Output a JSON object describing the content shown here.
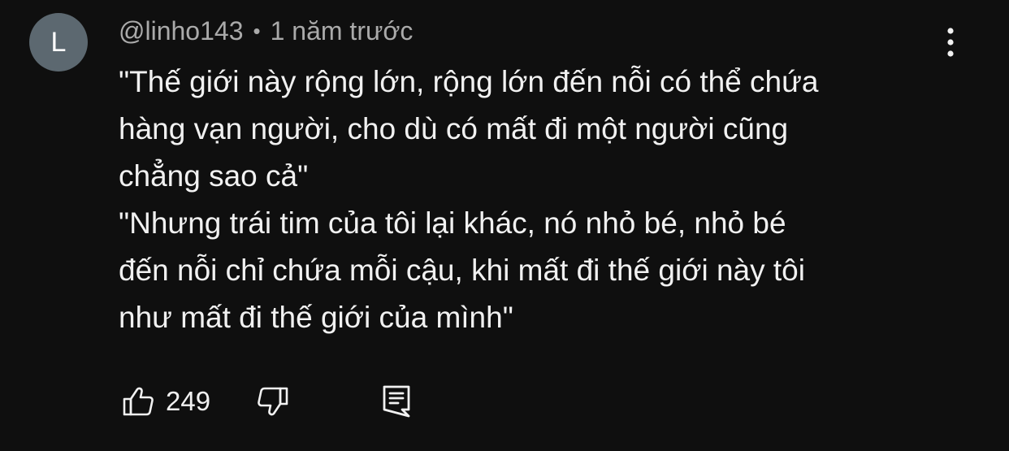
{
  "comment": {
    "avatar_letter": "L",
    "author": "@linho143",
    "separator": "•",
    "time": "1 năm trước",
    "text_lines": [
      "\"Thế giới này rộng lớn, rộng lớn đến nỗi có thể chứa",
      "hàng vạn người, cho dù có mất đi một người cũng",
      "chẳng sao cả\"",
      "\"Nhưng trái tim của tôi lại khác, nó nhỏ bé, nhỏ bé",
      "đến nỗi chỉ chứa mỗi cậu, khi mất đi thế giới này tôi",
      "như mất đi thế giới của mình\""
    ],
    "like_count": "249"
  },
  "icons": {
    "more": "more-vertical-icon",
    "like": "thumbs-up-icon",
    "dislike": "thumbs-down-icon",
    "reply": "comment-reply-icon"
  },
  "colors": {
    "background": "#0f0f0f",
    "text": "#f1f1f1",
    "meta": "#aaaaaa",
    "avatar": "#5c6870"
  }
}
